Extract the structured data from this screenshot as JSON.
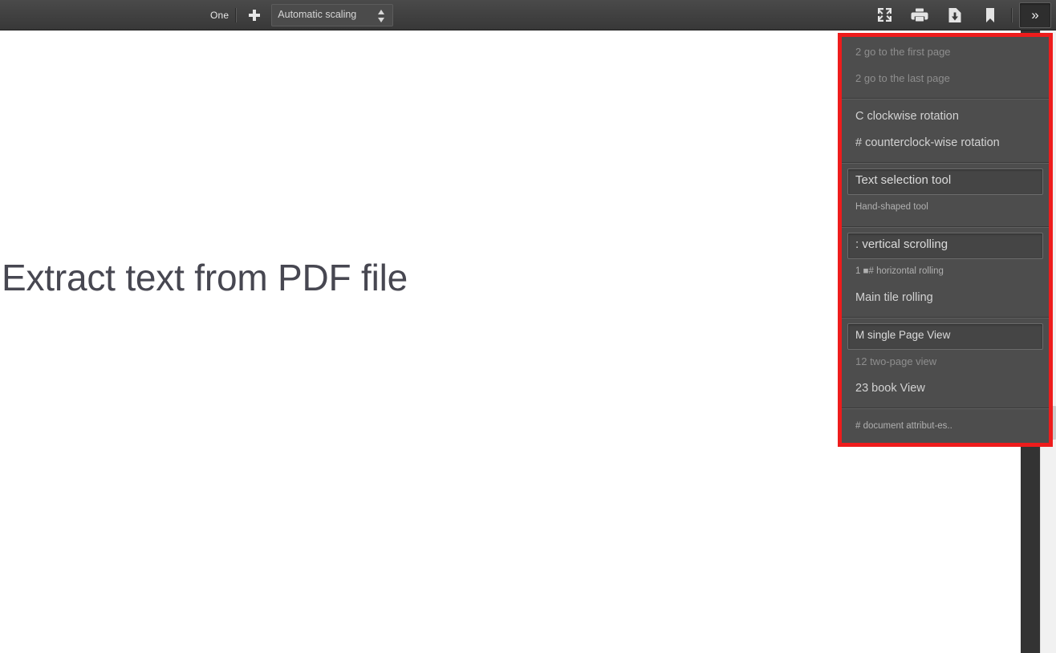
{
  "toolbar": {
    "zoom_label": "One",
    "zoom_in_icon": "plus-icon",
    "scale_value": "Automatic scaling",
    "scale_spinner_icon": "spinner-updown-icon",
    "presentation_icon": "fullscreen-icon",
    "print_icon": "print-icon",
    "download_icon": "download-icon",
    "bookmark_icon": "bookmark-icon",
    "more_tools_label": "»",
    "more_tools_icon": "double-chevron-right-icon"
  },
  "document": {
    "heading": "Extract text from PDF file"
  },
  "scrollbar": {
    "name": "vertical-scrollbar"
  },
  "secondary_menu": {
    "highlight_color": "#ee1c1c",
    "groups": [
      {
        "items": [
          {
            "label": "2 go to the first page",
            "style": "dim",
            "selected": false
          },
          {
            "label": "2 go to the last page",
            "style": "dim",
            "selected": false
          }
        ]
      },
      {
        "items": [
          {
            "label": "C clockwise rotation",
            "style": "bright",
            "selected": false
          },
          {
            "label": "# counterclock-wise rotation",
            "style": "bright",
            "selected": false
          }
        ]
      },
      {
        "items": [
          {
            "label": "Text selection tool",
            "style": "bright",
            "selected": true
          },
          {
            "label": "Hand-shaped tool",
            "style": "small",
            "selected": false
          }
        ]
      },
      {
        "items": [
          {
            "label": ": vertical scrolling",
            "style": "bright",
            "selected": true
          },
          {
            "label": "1 ■# horizontal rolling",
            "style": "small",
            "selected": false
          },
          {
            "label": "Main tile rolling",
            "style": "bright",
            "selected": false
          }
        ]
      },
      {
        "items": [
          {
            "label": "M single Page View",
            "style": "mid",
            "selected": true
          },
          {
            "label": "12 two-page view",
            "style": "dim",
            "selected": false
          },
          {
            "label": "23 book View",
            "style": "bright",
            "selected": false
          }
        ]
      },
      {
        "items": [
          {
            "label": "# document attribut-es..",
            "style": "small",
            "selected": false
          }
        ]
      }
    ]
  }
}
